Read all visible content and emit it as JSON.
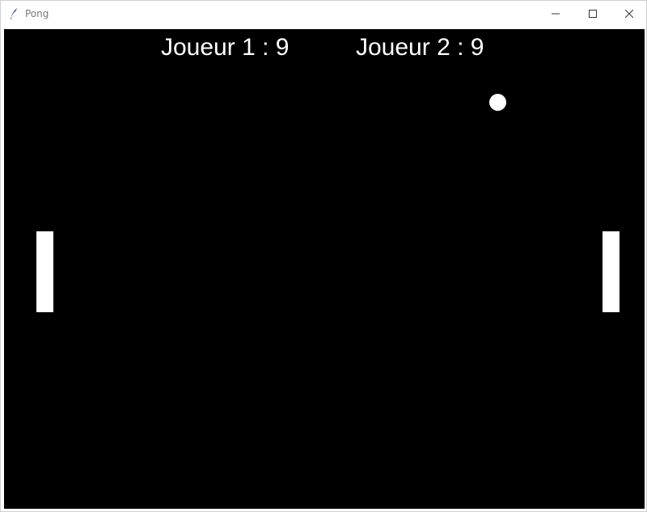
{
  "window": {
    "title": "Pong",
    "icon": "feather-icon",
    "controls": [
      "minimize-icon",
      "maximize-icon",
      "close-icon"
    ]
  },
  "game": {
    "background_color": "#000000",
    "foreground_color": "#ffffff",
    "scores": {
      "player1_label": "Joueur 1 : 9",
      "player2_label": "Joueur 2 : 9"
    }
  }
}
